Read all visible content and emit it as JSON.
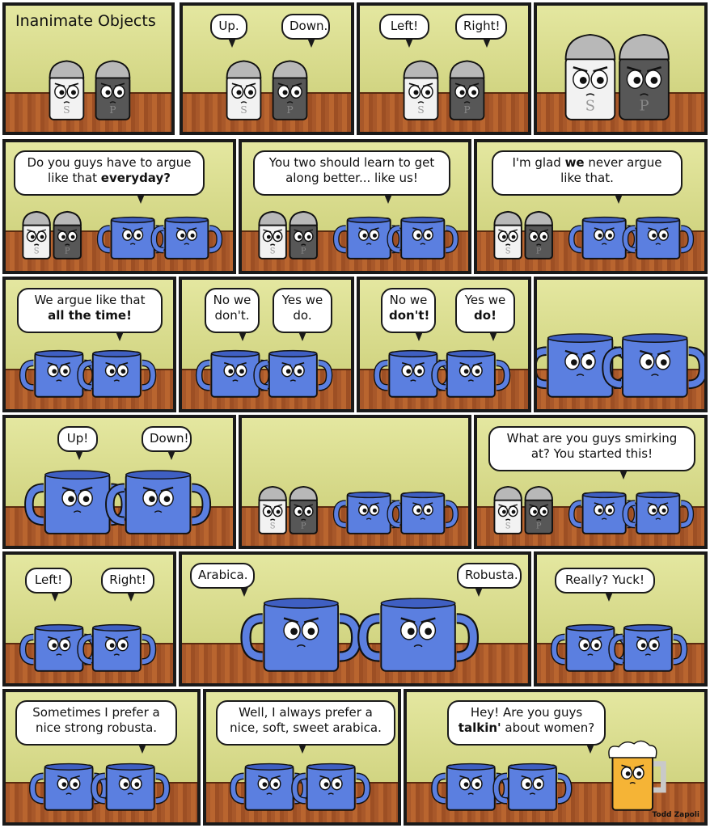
{
  "comic": {
    "title": "Inanimate Objects",
    "signature": "Todd Zapoli"
  },
  "panels": [
    {
      "id": 1,
      "characters": [
        "salt-shaker",
        "pepper-shaker"
      ],
      "bubbles": []
    },
    {
      "id": 2,
      "characters": [
        "salt-shaker",
        "pepper-shaker"
      ],
      "bubbles": [
        "Up.",
        "Down."
      ]
    },
    {
      "id": 3,
      "characters": [
        "salt-shaker",
        "pepper-shaker"
      ],
      "bubbles": [
        "Left!",
        "Right!"
      ]
    },
    {
      "id": 4,
      "characters": [
        "salt-shaker",
        "pepper-shaker"
      ],
      "bubbles": []
    },
    {
      "id": 5,
      "characters": [
        "salt-shaker",
        "pepper-shaker",
        "mug",
        "mug"
      ],
      "bubbles": [
        "Do you guys have to argue\nlike that everyday?"
      ]
    },
    {
      "id": 6,
      "characters": [
        "salt-shaker",
        "pepper-shaker",
        "mug",
        "mug"
      ],
      "bubbles": [
        "You two should learn to get\nalong better... like us!"
      ]
    },
    {
      "id": 7,
      "characters": [
        "salt-shaker",
        "pepper-shaker",
        "mug",
        "mug"
      ],
      "bubbles": [
        "I'm glad we never argue\nlike that."
      ]
    },
    {
      "id": 8,
      "characters": [
        "mug",
        "mug"
      ],
      "bubbles": [
        "We argue like that\nall the time!"
      ]
    },
    {
      "id": 9,
      "characters": [
        "mug",
        "mug"
      ],
      "bubbles": [
        "No we\ndon't.",
        "Yes we\ndo."
      ]
    },
    {
      "id": 10,
      "characters": [
        "mug",
        "mug"
      ],
      "bubbles": [
        "No we\ndon't!",
        "Yes we\ndo!"
      ]
    },
    {
      "id": 11,
      "characters": [
        "mug",
        "mug"
      ],
      "bubbles": []
    },
    {
      "id": 12,
      "characters": [
        "mug",
        "mug"
      ],
      "bubbles": [
        "Up!",
        "Down!"
      ]
    },
    {
      "id": 13,
      "characters": [
        "salt-shaker",
        "pepper-shaker",
        "mug",
        "mug"
      ],
      "bubbles": []
    },
    {
      "id": 14,
      "characters": [
        "salt-shaker",
        "pepper-shaker",
        "mug",
        "mug"
      ],
      "bubbles": [
        "What are you guys smirking\nat? You started this!"
      ]
    },
    {
      "id": 15,
      "characters": [
        "mug",
        "mug"
      ],
      "bubbles": [
        "Left!",
        "Right!"
      ]
    },
    {
      "id": 16,
      "characters": [
        "mug",
        "mug"
      ],
      "bubbles": [
        "Arabica.",
        "Robusta."
      ]
    },
    {
      "id": 17,
      "characters": [
        "mug",
        "mug"
      ],
      "bubbles": [
        "Really? Yuck!"
      ]
    },
    {
      "id": 18,
      "characters": [
        "mug",
        "mug"
      ],
      "bubbles": [
        "Sometimes I prefer a\nnice strong robusta."
      ]
    },
    {
      "id": 19,
      "characters": [
        "mug",
        "mug"
      ],
      "bubbles": [
        "Well, I always prefer a\nnice, soft, sweet arabica."
      ]
    },
    {
      "id": 20,
      "characters": [
        "mug",
        "mug",
        "beer-mug"
      ],
      "bubbles": [
        "Hey!  Are you guys\ntalkin' about women?"
      ]
    }
  ],
  "shaker_letters": {
    "salt": "S",
    "pepper": "P"
  },
  "colors": {
    "wall": "#d8db8c",
    "shelf": "#a8582a",
    "mug": "#5b7fe0",
    "salt": "#f3f3f3",
    "pepper": "#555555",
    "beer": "#f5b436",
    "border": "#1a1a1a"
  }
}
